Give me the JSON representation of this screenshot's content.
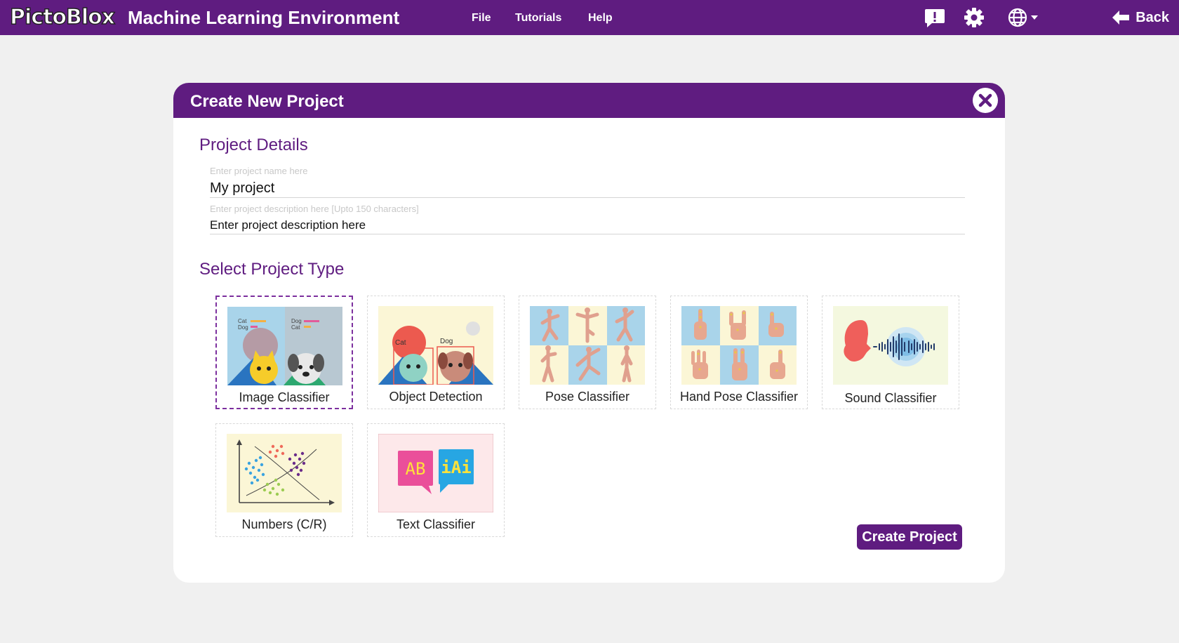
{
  "app": {
    "logo_text": "PictoBlox",
    "title": "Machine Learning Environment"
  },
  "menu": [
    {
      "label": "File"
    },
    {
      "label": "Tutorials"
    },
    {
      "label": "Help"
    }
  ],
  "topbar_icons": [
    "feedback-icon",
    "gear-icon",
    "globe-icon"
  ],
  "back_label": "Back",
  "modal": {
    "title": "Create New Project",
    "details_heading": "Project Details",
    "name_label": "Enter project name here",
    "name_value": "My project",
    "description_label": "Enter project description here [Upto 150 characters]",
    "description_value": "Enter project description here",
    "type_heading": "Select Project Type",
    "project_types": [
      {
        "label": "Image Classifier",
        "selected": true
      },
      {
        "label": "Object Detection",
        "selected": false
      },
      {
        "label": "Pose Classifier",
        "selected": false
      },
      {
        "label": "Hand Pose Classifier",
        "selected": false
      },
      {
        "label": "Sound Classifier",
        "selected": false
      },
      {
        "label": "Numbers (C/R)",
        "selected": false
      },
      {
        "label": "Text Classifier",
        "selected": false
      }
    ],
    "thumb_text": {
      "image_left": [
        "Cat",
        "Dog"
      ],
      "image_right": [
        "Dog",
        "Cat"
      ],
      "object_cat": "Cat",
      "object_dog": "Dog",
      "text_left": "AB",
      "text_right": "iAi"
    },
    "create_button": "Create Project"
  },
  "colors": {
    "brand": "#5f1c80",
    "background": "#f0f0f0",
    "card_border": "#d9d9d9",
    "selected_border": "#7c2f9e"
  }
}
